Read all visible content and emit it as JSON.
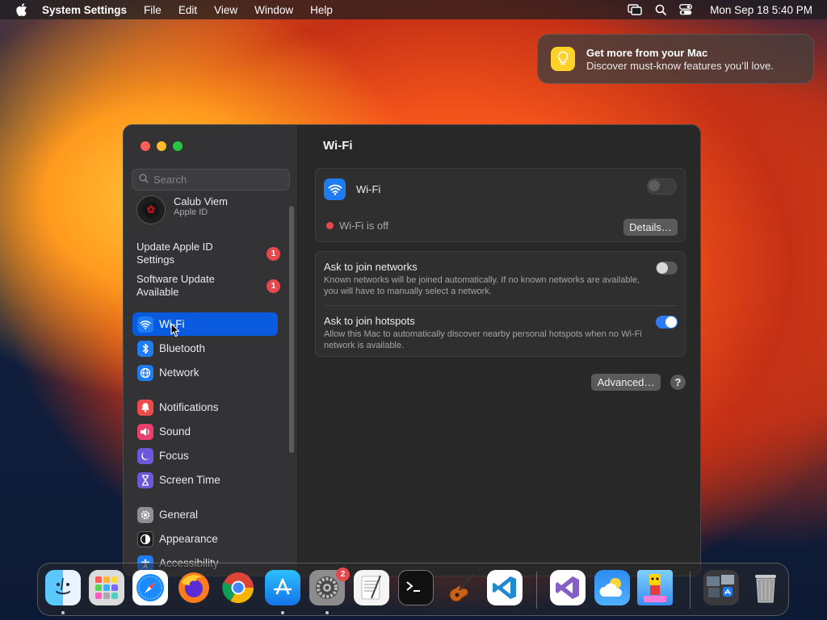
{
  "menubar": {
    "app_name": "System Settings",
    "menus": [
      "File",
      "Edit",
      "View",
      "Window",
      "Help"
    ],
    "clock": "Mon Sep 18  5:40 PM"
  },
  "notification": {
    "title": "Get more from your Mac",
    "body": "Discover must-know features you’ll love."
  },
  "sidebar": {
    "search_placeholder": "Search",
    "user": {
      "name": "Calub Viem",
      "subtitle": "Apple ID"
    },
    "notices": [
      {
        "label": "Update Apple ID Settings",
        "badge": "1"
      },
      {
        "label": "Software Update Available",
        "badge": "1"
      }
    ],
    "items": [
      {
        "label": "Wi-Fi",
        "icon": "wifi-icon",
        "color": "#1e7cf2",
        "selected": true
      },
      {
        "label": "Bluetooth",
        "icon": "bluetooth-icon",
        "color": "#1e7cf2"
      },
      {
        "label": "Network",
        "icon": "globe-icon",
        "color": "#1e7cf2"
      },
      {
        "label": "Notifications",
        "icon": "bell-icon",
        "color": "#ef4a4a"
      },
      {
        "label": "Sound",
        "icon": "speaker-icon",
        "color": "#ea3f6a"
      },
      {
        "label": "Focus",
        "icon": "moon-icon",
        "color": "#6a5ad9"
      },
      {
        "label": "Screen Time",
        "icon": "hourglass-icon",
        "color": "#6a5ad9"
      },
      {
        "label": "General",
        "icon": "gear-icon",
        "color": "#8e8e93"
      },
      {
        "label": "Appearance",
        "icon": "appearance-icon",
        "color": "#1c1c1e"
      },
      {
        "label": "Accessibility",
        "icon": "accessibility-icon",
        "color": "#1e7cf2"
      }
    ]
  },
  "main": {
    "title": "Wi-Fi",
    "wifi_label": "Wi-Fi",
    "status": "Wi-Fi is off",
    "details_button": "Details…",
    "ask_networks": {
      "title": "Ask to join networks",
      "description": "Known networks will be joined automatically. If no known networks are available, you will have to manually select a network.",
      "on": false
    },
    "ask_hotspots": {
      "title": "Ask to join hotspots",
      "description": "Allow this Mac to automatically discover nearby personal hotspots when no Wi-Fi network is available.",
      "on": true
    },
    "advanced_button": "Advanced…",
    "help_button": "?"
  },
  "dock": {
    "apps": [
      "finder",
      "launchpad",
      "safari",
      "firefox",
      "chrome",
      "app-store",
      "system-settings",
      "textedit",
      "terminal",
      "garageband",
      "vscode",
      "visual-studio",
      "weather",
      "game",
      "downloads-stack",
      "trash"
    ],
    "system_settings_badge": "2"
  },
  "colors": {
    "accent": "#0a5ae0",
    "badge": "#e5484d",
    "status_off": "#e5484d"
  }
}
